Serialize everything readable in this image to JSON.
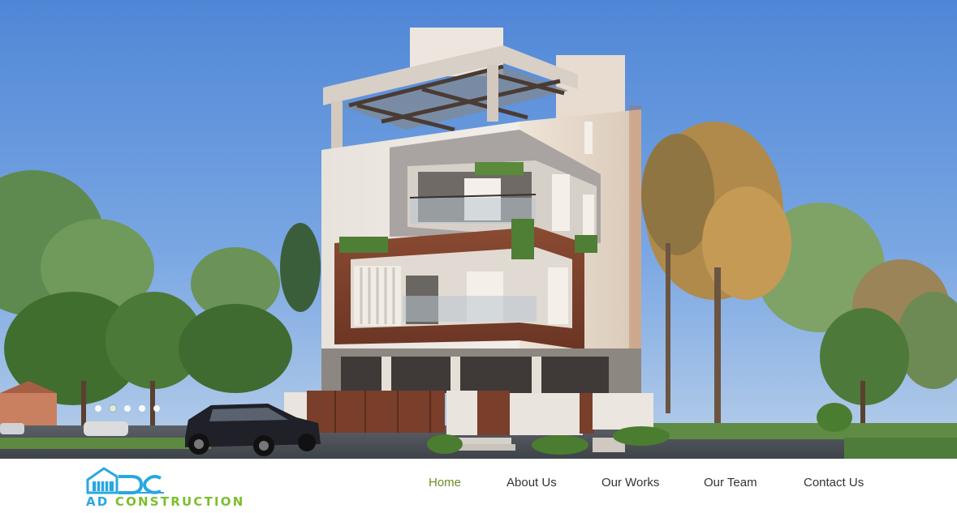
{
  "brand": {
    "logo_text_prefix": "AD",
    "logo_text_rest": " CONSTRUCTION",
    "colors": {
      "blue": "#29a7e1",
      "green": "#7cbf2f"
    }
  },
  "nav": {
    "items": [
      {
        "label": "Home",
        "active": true
      },
      {
        "label": "About Us",
        "active": false
      },
      {
        "label": "Our Works",
        "active": false
      },
      {
        "label": "Our Team",
        "active": false
      },
      {
        "label": "Contact Us",
        "active": false
      }
    ],
    "active_color": "#6b8e23",
    "text_color": "#333333"
  },
  "hero": {
    "slide_count": 5,
    "active_slide": 2,
    "image_subject": "modern-house-render"
  }
}
